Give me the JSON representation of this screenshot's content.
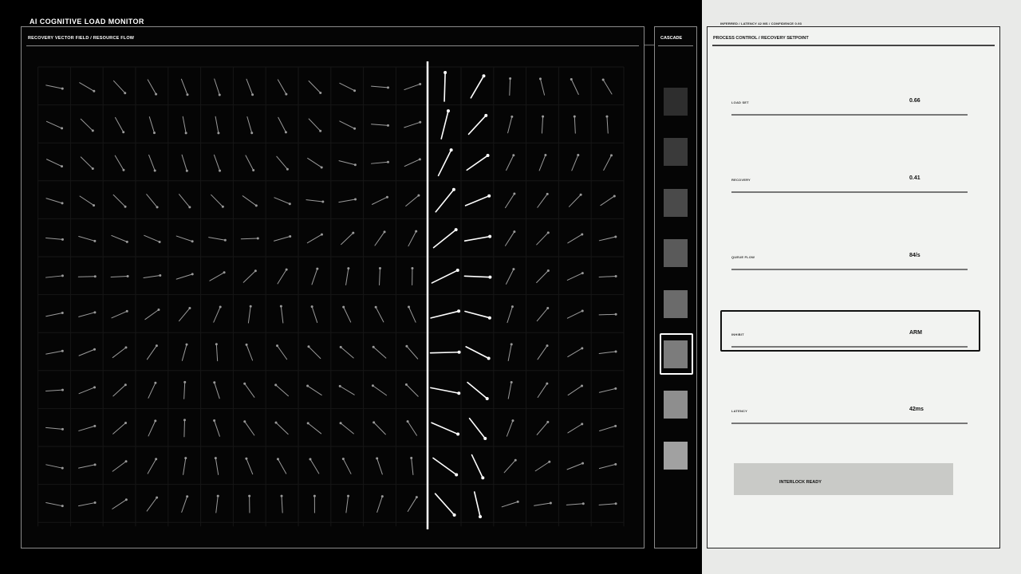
{
  "app": {
    "title": "AI COGNITIVE LOAD MONITOR",
    "status_line": "INFERRED / LATENCY 42 MS / CONFIDENCE 0.93"
  },
  "field_panel": {
    "title": "RECOVERY VECTOR FIELD / RESOURCE FLOW"
  },
  "cascade": {
    "title": "CASCADE",
    "levels": [
      {
        "color": "#2e2e2e"
      },
      {
        "color": "#3a3a3a"
      },
      {
        "color": "#4a4a4a"
      },
      {
        "color": "#5a5a5a"
      },
      {
        "color": "#6b6b6b"
      },
      {
        "color": "#7c7c7c"
      },
      {
        "color": "#8e8e8e"
      },
      {
        "color": "#a1a1a1"
      }
    ],
    "selected_index": 5
  },
  "control": {
    "title": "PROCESS CONTROL / RECOVERY SETPOINT",
    "params": [
      {
        "label": "LOAD SET",
        "value": "0.66"
      },
      {
        "label": "RECOVERY",
        "value": "0.41"
      },
      {
        "label": "QUEUE FLOW",
        "value": "84/s"
      },
      {
        "label": "INHIBIT",
        "value": "ARM"
      },
      {
        "label": "LATENCY",
        "value": "42ms"
      }
    ],
    "focused_index": 3,
    "interlock_label": "INTERLOCK READY"
  },
  "colors": {
    "background_dark": "#000000",
    "background_light": "#e9eae8",
    "accent_white": "#ffffff",
    "vector_gray": "#9a9a9a"
  }
}
